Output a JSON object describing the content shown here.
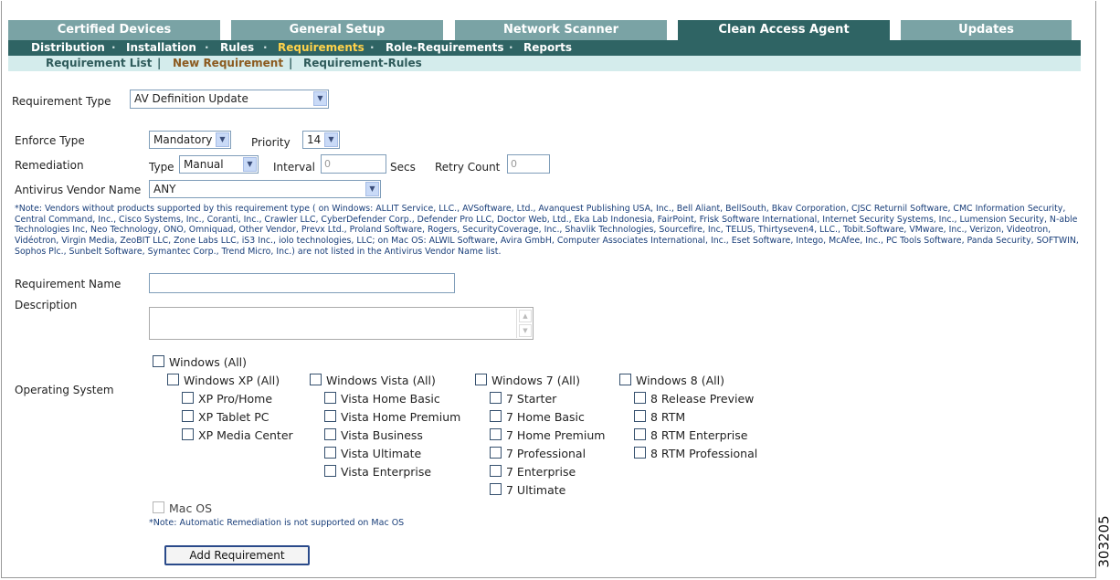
{
  "tabs": [
    {
      "label": "Certified Devices",
      "active": false
    },
    {
      "label": "General Setup",
      "active": false
    },
    {
      "label": "Network Scanner",
      "active": false
    },
    {
      "label": "Clean Access Agent",
      "active": true
    },
    {
      "label": "Updates",
      "active": false
    }
  ],
  "subnav": {
    "items": [
      "Distribution",
      "Installation",
      "Rules",
      "Requirements",
      "Role-Requirements",
      "Reports"
    ],
    "separator": "·",
    "current": "Requirements"
  },
  "subnav2": {
    "items": [
      "Requirement List",
      "New Requirement",
      "Requirement-Rules"
    ],
    "separator": "|",
    "current": "New Requirement"
  },
  "form": {
    "requirement_type": {
      "label": "Requirement Type",
      "value": "AV Definition Update"
    },
    "enforce_type": {
      "label": "Enforce Type",
      "value": "Mandatory"
    },
    "priority": {
      "label": "Priority",
      "value": "14"
    },
    "remediation": {
      "label": "Remediation",
      "type_label": "Type",
      "type_value": "Manual",
      "interval_label": "Interval",
      "interval_value": "0",
      "interval_unit": "Secs",
      "retry_label": "Retry Count",
      "retry_value": "0"
    },
    "av_vendor": {
      "label": "Antivirus Vendor Name",
      "value": "ANY"
    },
    "note": "*Note: Vendors without products supported by this requirement type ( on Windows: ALLIT Service, LLC., AVSoftware, Ltd., Avanquest Publishing USA, Inc., Bell Aliant, BellSouth, Bkav Corporation, CJSC Returnil Software, CMC Information Security, Central Command, Inc., Cisco Systems, Inc., Coranti, Inc., Crawler LLC, CyberDefender Corp., Defender Pro LLC, Doctor Web, Ltd., Eka Lab Indonesia, FairPoint, Frisk Software International, Internet Security Systems, Inc., Lumension Security, N-able Technologies Inc, Neo Technology, ONO, Omniquad, Other Vendor, Prevx Ltd., Proland Software, Rogers, SecurityCoverage, Inc., Shavlik Technologies, Sourcefire, Inc, TELUS, Thirtyseven4, LLC., Tobit.Software, VMware, Inc., Verizon, Videotron, Vidéotron, Virgin Media, ZeoBIT LLC, Zone Labs LLC, iS3 Inc., iolo technologies, LLC; on Mac OS: ALWIL Software, Avira GmbH, Computer Associates International, Inc., Eset Software, Intego, McAfee, Inc., PC Tools Software, Panda Security, SOFTWIN, Sophos Plc., Sunbelt Software, Symantec Corp., Trend Micro, Inc.) are not listed in the Antivirus Vendor Name list.",
    "requirement_name": {
      "label": "Requirement Name",
      "value": ""
    },
    "description": {
      "label": "Description",
      "value": ""
    },
    "os_label": "Operating System"
  },
  "os": {
    "windows_all": "Windows (All)",
    "xp": {
      "group": "Windows XP (All)",
      "items": [
        "XP Pro/Home",
        "XP Tablet PC",
        "XP Media Center"
      ]
    },
    "vista": {
      "group": "Windows Vista (All)",
      "items": [
        "Vista Home Basic",
        "Vista Home Premium",
        "Vista Business",
        "Vista Ultimate",
        "Vista Enterprise"
      ]
    },
    "win7": {
      "group": "Windows 7 (All)",
      "items": [
        "7 Starter",
        "7 Home Basic",
        "7 Home Premium",
        "7 Professional",
        "7 Enterprise",
        "7 Ultimate"
      ]
    },
    "win8": {
      "group": "Windows 8 (All)",
      "items": [
        "8 Release Preview",
        "8 RTM",
        "8 RTM Enterprise",
        "8 RTM Professional"
      ]
    },
    "mac": "Mac OS",
    "mac_note": "*Note: Automatic Remediation is not supported on Mac OS"
  },
  "submit_label": "Add Requirement",
  "figure_number": "303205",
  "icons": {
    "dropdown": "chevron-down-icon",
    "scroll_up": "scroll-up-icon",
    "scroll_down": "scroll-down-icon"
  }
}
